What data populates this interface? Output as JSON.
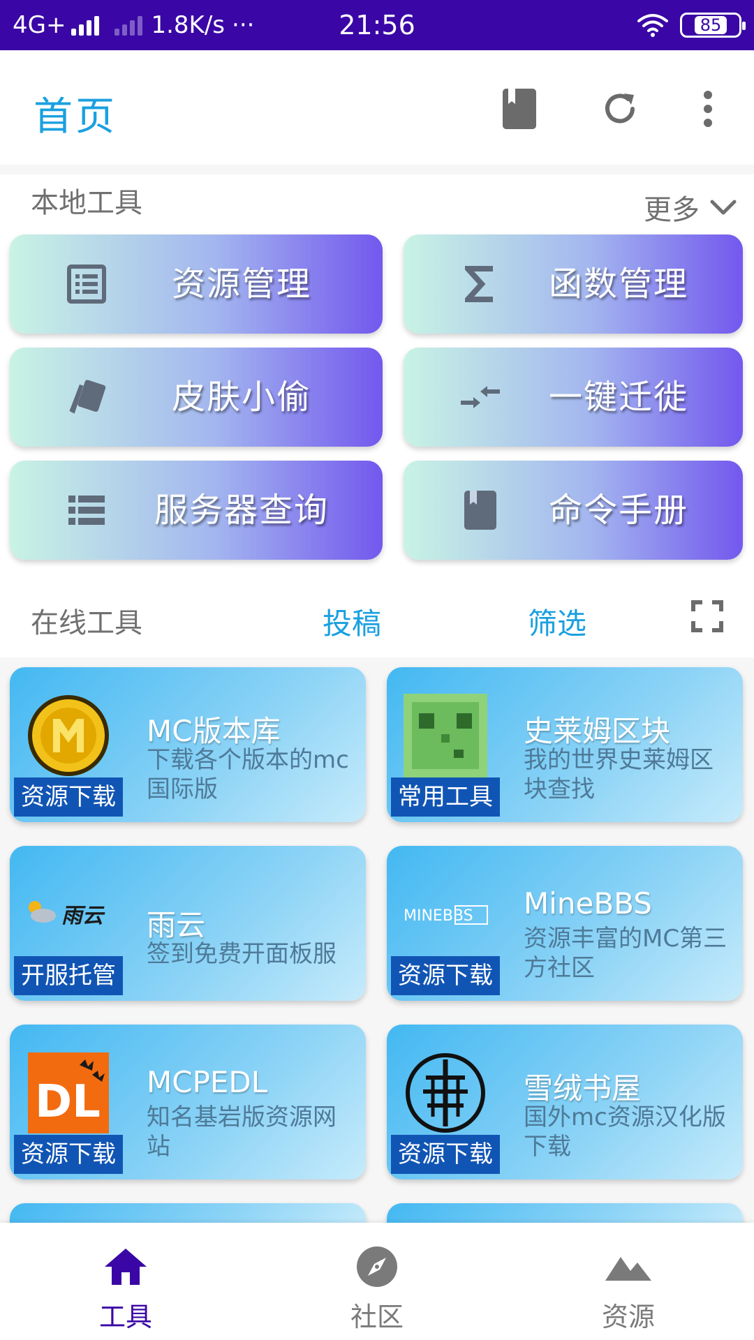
{
  "status_bar": {
    "network": "4G+",
    "speed": "1.8K/s",
    "more": "···",
    "time": "21:56",
    "battery": "85"
  },
  "app_bar": {
    "title": "首页",
    "icons": [
      "bookmark-icon",
      "refresh-icon",
      "more-vert-icon"
    ]
  },
  "local_tools": {
    "heading": "本地工具",
    "more_label": "更多",
    "items": [
      {
        "label": "资源管理",
        "icon": "list-alt-icon"
      },
      {
        "label": "函数管理",
        "icon": "sigma-icon"
      },
      {
        "label": "皮肤小偷",
        "icon": "cards-icon"
      },
      {
        "label": "一键迁徙",
        "icon": "compress-arrows-icon"
      },
      {
        "label": "服务器查询",
        "icon": "list-icon"
      },
      {
        "label": "命令手册",
        "icon": "book-icon"
      }
    ]
  },
  "online_tools": {
    "heading": "在线工具",
    "submit_label": "投稿",
    "filter_label": "筛选",
    "fullscreen_icon": "fullscreen-icon"
  },
  "cards": [
    {
      "title": "MC版本库",
      "desc": "下载各个版本的mc国际版",
      "badge": "资源下载",
      "logo": "gold-coin-logo"
    },
    {
      "title": "史莱姆区块",
      "desc": "我的世界史莱姆区块查找",
      "badge": "常用工具",
      "logo": "slime-logo"
    },
    {
      "title": "雨云",
      "desc": "签到免费开面板服",
      "badge": "开服托管",
      "logo": "rainyun-logo",
      "logo_text": "雨云"
    },
    {
      "title": "MineBBS",
      "desc": "资源丰富的MC第三方社区",
      "badge": "资源下载",
      "logo": "minebbs-logo",
      "logo_text": "MINEBBS"
    },
    {
      "title": "MCPEDL",
      "desc": "知名基岩版资源网站",
      "badge": "资源下载",
      "logo": "mcpedl-logo",
      "logo_text": "DL"
    },
    {
      "title": "雪绒书屋",
      "desc": "国外mc资源汉化版下载",
      "badge": "资源下载",
      "logo": "tree-circle-logo"
    }
  ],
  "bottom_nav": [
    {
      "label": "工具",
      "icon": "home-icon",
      "active": true
    },
    {
      "label": "社区",
      "icon": "compass-icon",
      "active": false
    },
    {
      "label": "资源",
      "icon": "mountain-icon",
      "active": false
    }
  ],
  "colors": {
    "status_bar": "#3a07a6",
    "accent": "#1aa0e0",
    "badge": "#1155b4",
    "nav_active": "#3a07a6"
  }
}
